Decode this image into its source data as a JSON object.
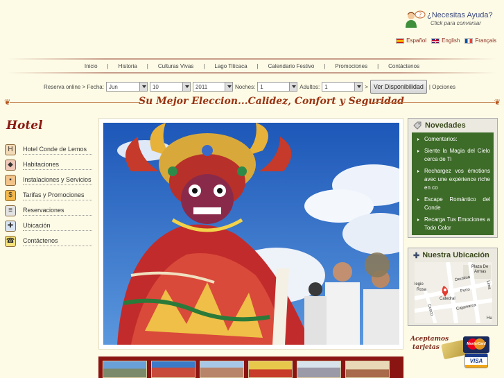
{
  "help": {
    "question": "¿Necesitas Ayuda?",
    "subtitle": "Click para conversar"
  },
  "languages": [
    "Español",
    "English",
    "Français"
  ],
  "nav": [
    "Inicio",
    "Historia",
    "Culturas Vivas",
    "Lago Titicaca",
    "Calendario Festivo",
    "Promociones",
    "Contáctenos"
  ],
  "booking": {
    "label": "Reserva online > Fecha:",
    "month": "Jun",
    "day": "10",
    "year": "2011",
    "nights_label": "Noches:",
    "nights": "1",
    "adults_label": "Adultos:",
    "adults": "1",
    "arrow": ">",
    "button": "Ver Disponibilidad",
    "options": "| Opciones"
  },
  "slogan": "Su Mejor Eleccion...Calidez, Confort y Seguridad",
  "sidebar": {
    "title": "Hotel",
    "items": [
      {
        "label": "Hotel Conde de Lemos",
        "icon": "hotel-h-icon",
        "color": "#f3d9b5",
        "glyph": "H"
      },
      {
        "label": "Habitaciones",
        "icon": "room-icon",
        "color": "#f0c8b8",
        "glyph": "◆"
      },
      {
        "label": "Instalaciones y Servicios",
        "icon": "luggage-icon",
        "color": "#f3c48a",
        "glyph": "▪"
      },
      {
        "label": "Tarifas y Promociones",
        "icon": "price-icon",
        "color": "#f5b94a",
        "glyph": "$"
      },
      {
        "label": "Reservaciones",
        "icon": "reservation-icon",
        "color": "#e2e2e2",
        "glyph": "≡"
      },
      {
        "label": "Ubicación",
        "icon": "location-icon",
        "color": "#d9e4f2",
        "glyph": "✚"
      },
      {
        "label": "Contáctenos",
        "icon": "phone-icon",
        "color": "#f5e27a",
        "glyph": "☎"
      }
    ]
  },
  "novedades": {
    "title": "Novedades",
    "items": [
      "Comentarios:",
      "Siente la Magia del Cielo cerca de Ti",
      "Rechargez vos émotions avec une expérience riche en co",
      "Escape Romántico del Conde",
      "Recarga Tus Emociones a Todo Color"
    ]
  },
  "ubicacion": {
    "title": "Nuestra Ubicación",
    "map_labels": [
      "Plaza De",
      "Armas",
      "Deustua",
      "Puno",
      "Lima",
      "legio",
      "Rosa",
      "Catedral",
      "Cajamarca",
      "Cusco",
      "Hu"
    ]
  },
  "cards": {
    "label_line1": "Aceptamos",
    "label_line2": "tarjetas",
    "card1": "MasterCard",
    "card2": "VISA"
  },
  "colors": {
    "brand": "#8a1411",
    "novedades_bg": "#3d6b28",
    "slogan": "#9a3312",
    "page_bg": "#fdfbe6"
  }
}
